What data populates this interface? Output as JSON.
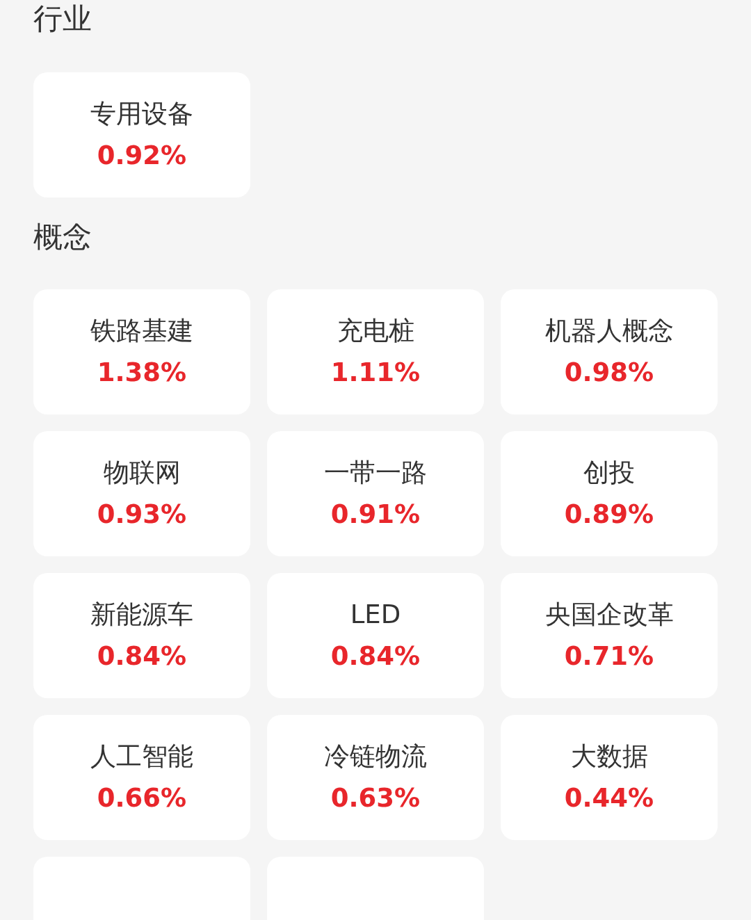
{
  "sections": [
    {
      "title": "行业",
      "cards": [
        {
          "kind": "full",
          "name": "专用设备",
          "change": "0.92%"
        }
      ]
    },
    {
      "title": "概念",
      "cards": [
        {
          "kind": "full",
          "name": "铁路基建",
          "change": "1.38%"
        },
        {
          "kind": "full",
          "name": "充电桩",
          "change": "1.11%"
        },
        {
          "kind": "full",
          "name": "机器人概念",
          "change": "0.98%"
        },
        {
          "kind": "full",
          "name": "物联网",
          "change": "0.93%"
        },
        {
          "kind": "full",
          "name": "一带一路",
          "change": "0.91%"
        },
        {
          "kind": "full",
          "name": "创投",
          "change": "0.89%"
        },
        {
          "kind": "full",
          "name": "新能源车",
          "change": "0.84%"
        },
        {
          "kind": "full",
          "name": "LED",
          "change": "0.84%"
        },
        {
          "kind": "full",
          "name": "央国企改革",
          "change": "0.71%"
        },
        {
          "kind": "full",
          "name": "人工智能",
          "change": "0.66%"
        },
        {
          "kind": "full",
          "name": "冷链物流",
          "change": "0.63%"
        },
        {
          "kind": "full",
          "name": "大数据",
          "change": "0.44%"
        },
        {
          "kind": "cut"
        },
        {
          "kind": "cut"
        }
      ]
    }
  ]
}
